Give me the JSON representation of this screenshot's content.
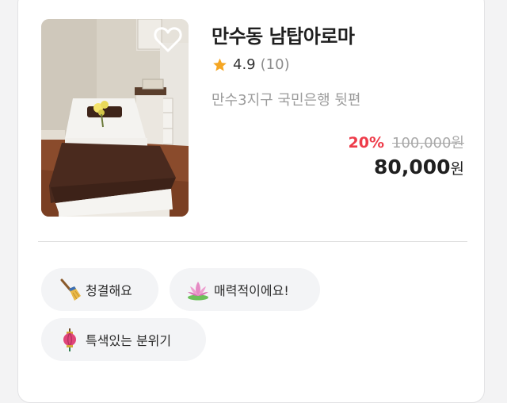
{
  "listing": {
    "name": "만수동 남탑아로마",
    "rating": "4.9",
    "review_count": "(10)",
    "address": "만수3지구 국민은행 뒷편",
    "discount": "20%",
    "original_price": "100,000원",
    "price_amount": "80,000",
    "price_unit": "원",
    "wishlist_icon": "heart-outline-icon",
    "star_icon": "star-icon"
  },
  "tags": [
    {
      "label": "청결해요",
      "icon": "broom-icon"
    },
    {
      "label": "매력적이에요!",
      "icon": "lotus-icon"
    },
    {
      "label": "특색있는 분위기",
      "icon": "lantern-icon"
    }
  ],
  "colors": {
    "discount": "#ee3c4a",
    "star": "#f5a623",
    "tag_background": "#f3f4f6",
    "original_price": "#a9a9a9"
  }
}
